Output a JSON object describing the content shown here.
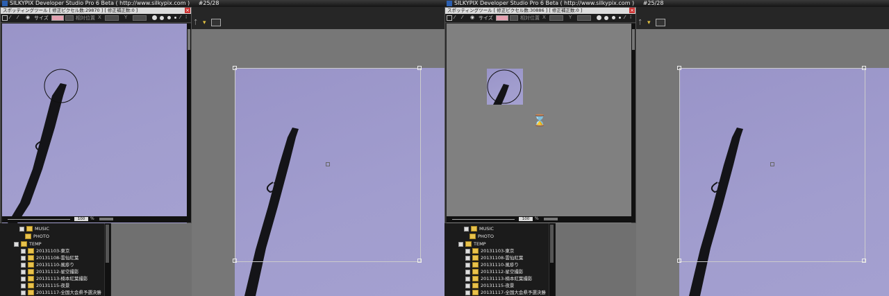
{
  "panels": [
    {
      "app_title": "SILKYPIX Developer Studio Pro 6 Beta ( http://www.silkypix.com )",
      "counter": "#25/28",
      "dialog": {
        "title": "スポッティングツール [ 修正ピクセル数:29870 ] [ 修正補正数:0 ]",
        "size_label": "サイズ",
        "rel_pos_label": "相対位置",
        "x_label": "X",
        "y_label": "Y",
        "zoom_value": "100",
        "zoom_unit": "%"
      },
      "tree": [
        "MUSIC",
        "PHOTO",
        "TEMP",
        "20131103-東京",
        "20131108-雲仙紅葉",
        "20131110-風疹り",
        "20131112-星空撮影",
        "20131113-楠本紅葉撮影",
        "20131115-夜景",
        "20131117-全国大会県予選決勝"
      ]
    },
    {
      "app_title": "SILKYPIX Developer Studio Pro 6 Beta ( http://www.silkypix.com )",
      "counter": "#25/28",
      "dialog": {
        "title": "スポッティングツール [ 修正ピクセル数:30886 ] [ 修正補正数:0 ]",
        "size_label": "サイズ",
        "rel_pos_label": "相対位置",
        "x_label": "X",
        "y_label": "Y",
        "zoom_value": "100",
        "zoom_unit": "%"
      },
      "tree": [
        "MUSIC",
        "PHOTO",
        "TEMP",
        "20131103-東京",
        "20131108-雲仙紅葉",
        "20131110-風疹り",
        "20131112-星空撮影",
        "20131113-楠本紅葉撮影",
        "20131115-夜景",
        "20131117-全国大会県予選決勝"
      ]
    }
  ],
  "icons": {
    "hourglass": "hourglass-icon",
    "folder": "folder-icon",
    "expand": "expand-icon"
  }
}
